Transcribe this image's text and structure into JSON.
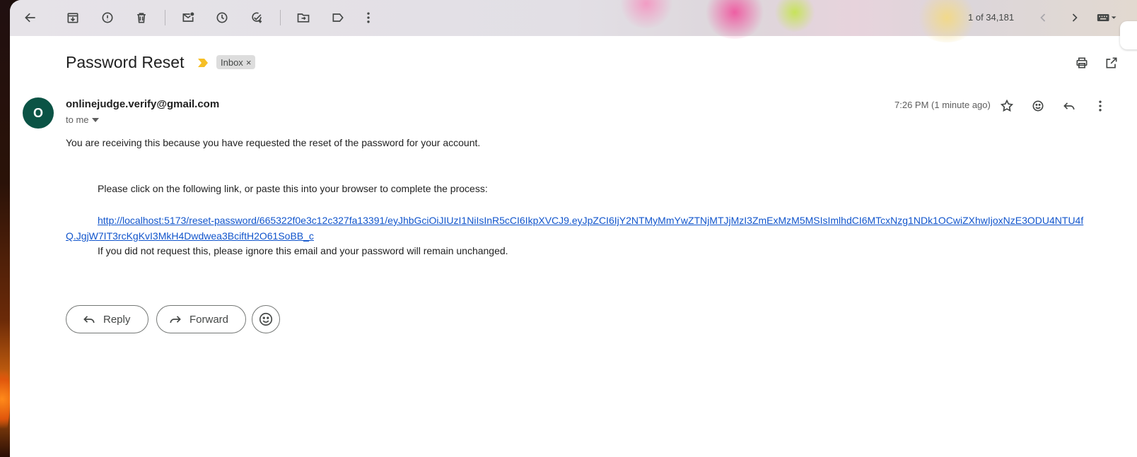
{
  "toolbar": {
    "pager_text": "1 of 34,181",
    "icons": [
      "back-arrow-icon",
      "archive-icon",
      "report-spam-icon",
      "delete-icon",
      "mark-unread-icon",
      "snooze-icon",
      "add-to-tasks-icon",
      "move-to-icon",
      "label-icon",
      "more-vertical-icon",
      "chevron-left-icon",
      "chevron-right-icon",
      "keyboard-icon"
    ]
  },
  "email": {
    "subject": "Password Reset",
    "label": "Inbox",
    "label_remove": "×",
    "avatar_letter": "O",
    "sender": "onlinejudge.verify@gmail.com",
    "recipient": "to me",
    "timestamp": "7:26 PM (1 minute ago)",
    "body_line1": "You are receiving this because you have requested the reset of the password for your account.",
    "body_line2": "Please click on the following link, or paste this into your browser to complete the process:",
    "reset_link": "http://localhost:5173/reset-password/665322f0e3c12c327fa13391/eyJhbGciOiJIUzI1NiIsInR5cCI6IkpXVCJ9.eyJpZCI6IjY2NTMyMmYwZTNjMTJjMzI3ZmExMzM5MSIsImlhdCI6MTcxNzg1NDk1OCwiZXhwIjoxNzE3ODU4NTU4fQ.JgjW7IT3rcKgKvI3MkH4Dwdwea3BciftH2O61SoBB_c",
    "body_line3": "If you did not request this, please ignore this email and your password will remain unchanged."
  },
  "actions": {
    "reply_label": "Reply",
    "forward_label": "Forward"
  },
  "colors": {
    "avatar_bg": "#0b5345",
    "link": "#1155cc",
    "important_marker": "#f6bf26"
  }
}
